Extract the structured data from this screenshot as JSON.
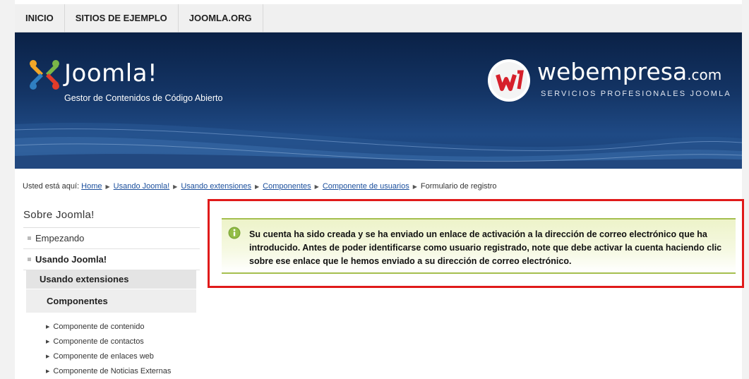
{
  "nav": {
    "items": [
      "INICIO",
      "SITIOS DE EJEMPLO",
      "JOOMLA.ORG"
    ]
  },
  "header": {
    "brand_name": "Joomla!",
    "tagline": "Gestor de Contenidos de Código Abierto",
    "partner_name": "webempresa",
    "partner_tld": ".com",
    "partner_tagline": "SERVICIOS PROFESIONALES JOOMLA"
  },
  "breadcrumb": {
    "prefix": "Usted está aquí:",
    "links": [
      "Home",
      "Usando Joomla!",
      "Usando extensiones",
      "Componentes",
      "Componente de usuarios"
    ],
    "current": "Formulario de registro"
  },
  "sidebar": {
    "title": "Sobre Joomla!",
    "items": [
      "Empezando",
      "Usando Joomla!"
    ],
    "active_section": "Usando extensiones",
    "active_subsection": "Componentes",
    "sub_items": [
      "Componente de contenido",
      "Componente de contactos",
      "Componente de enlaces web",
      "Componente de Noticias Externas"
    ]
  },
  "message": {
    "text": "Su cuenta ha sido creada y se ha enviado un enlace de activación a la dirección de correo electrónico que ha introducido. Antes de poder identificarse como usuario registrado, note que debe activar la cuenta haciendo clic sobre ese enlace que le hemos enviado a su dirección de correo electrónico."
  },
  "colors": {
    "header_bg": "#143566",
    "highlight_border": "#e01a1a",
    "message_rule": "#a5bf4f",
    "link": "#1a4e9c"
  }
}
